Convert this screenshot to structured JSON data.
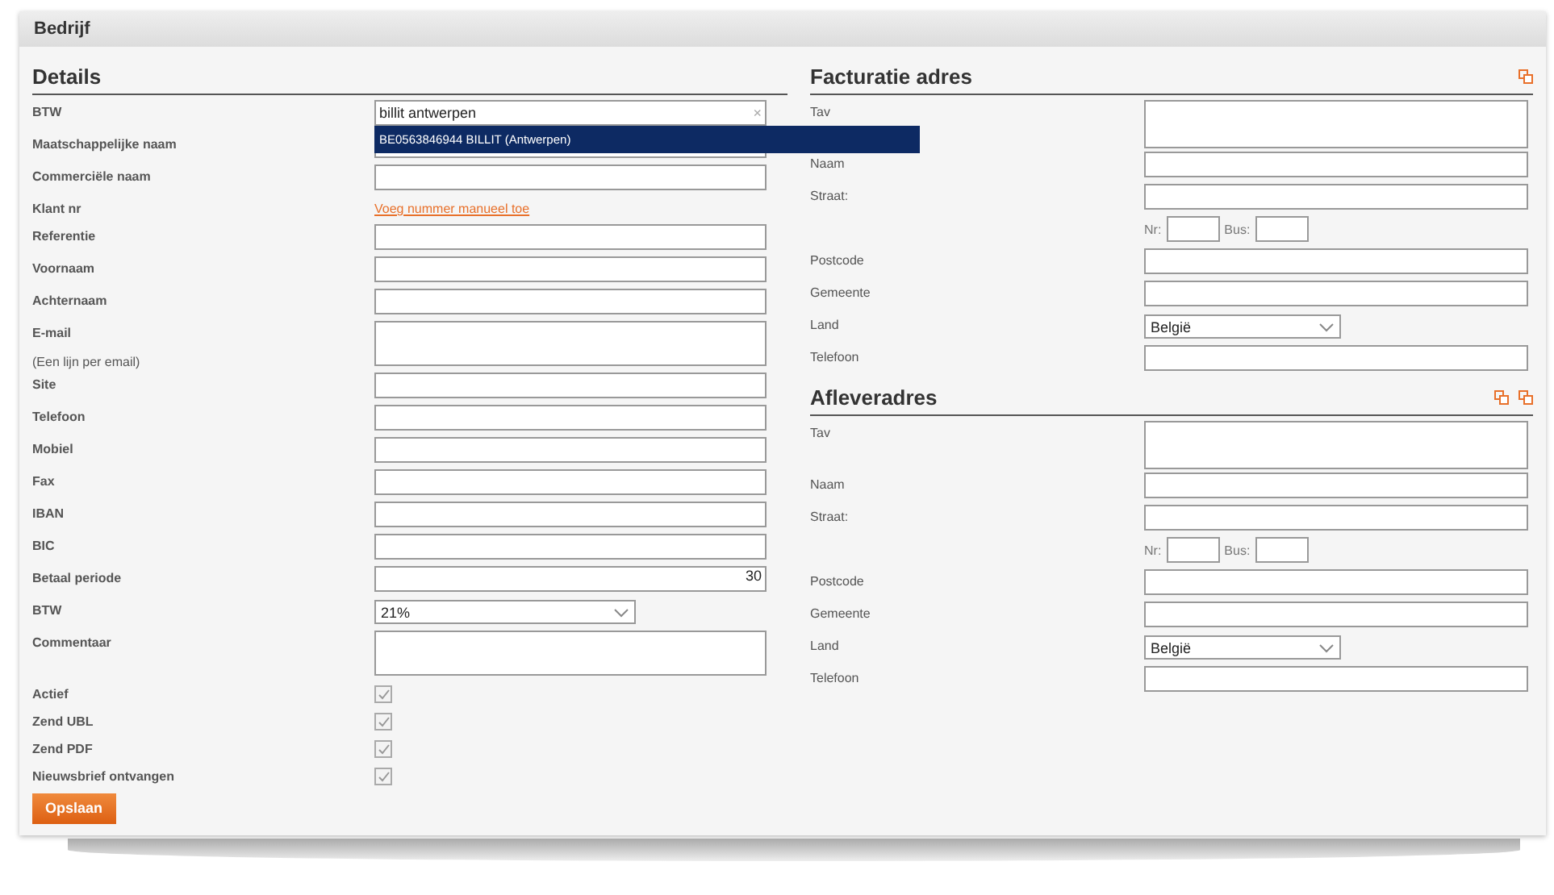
{
  "panel": {
    "title": "Bedrijf"
  },
  "details": {
    "heading": "Details",
    "rows": [
      {
        "label": "BTW",
        "kind": "autocomplete",
        "value": "billit antwerpen",
        "clear": "×",
        "suggestion": "BE0563846944 BILLIT (Antwerpen)"
      },
      {
        "label": "Maatschappelijke naam",
        "kind": "input"
      },
      {
        "label": "Commerciële naam",
        "kind": "input"
      },
      {
        "label": "Klant nr",
        "kind": "link",
        "link": "Voeg nummer manueel toe"
      },
      {
        "label": "Referentie",
        "kind": "input"
      },
      {
        "label": "Voornaam",
        "kind": "input"
      },
      {
        "label": "Achternaam",
        "kind": "input"
      },
      {
        "label": "E-mail",
        "kind": "textarea",
        "note": "(Een lijn per email)"
      },
      {
        "label": "Site",
        "kind": "input"
      },
      {
        "label": "Telefoon",
        "kind": "input"
      },
      {
        "label": "Mobiel",
        "kind": "input"
      },
      {
        "label": "Fax",
        "kind": "input"
      },
      {
        "label": "IBAN",
        "kind": "input"
      },
      {
        "label": "BIC",
        "kind": "input"
      },
      {
        "label": "Betaal periode",
        "kind": "number",
        "value": "30"
      },
      {
        "label": "BTW",
        "kind": "select",
        "value": "21%"
      },
      {
        "label": "Commentaar",
        "kind": "textarea"
      },
      {
        "label": "Actief",
        "kind": "checkbox",
        "checked": true
      },
      {
        "label": "Zend UBL",
        "kind": "checkbox",
        "checked": true
      },
      {
        "label": "Zend PDF",
        "kind": "checkbox",
        "checked": true
      },
      {
        "label": "Nieuwsbrief ontvangen",
        "kind": "checkbox",
        "checked": true
      }
    ],
    "save_button": "Opslaan"
  },
  "addresses": [
    {
      "heading": "Facturatie adres",
      "actions": [
        {
          "kind": "copy"
        }
      ],
      "rows": [
        {
          "label": "Tav",
          "kind": "textarea"
        },
        {
          "label": "Naam",
          "kind": "input"
        },
        {
          "label": "Straat:",
          "kind": "input"
        },
        {
          "kind": "nrbus",
          "nr_label": "Nr:",
          "bus_label": "Bus:"
        },
        {
          "label": "Postcode",
          "kind": "input"
        },
        {
          "label": "Gemeente",
          "kind": "input"
        },
        {
          "label": "Land",
          "kind": "select",
          "value": "België"
        },
        {
          "label": "Telefoon",
          "kind": "input"
        }
      ]
    },
    {
      "heading": "Afleveradres",
      "actions": [
        {
          "kind": "copy"
        },
        {
          "kind": "copy"
        }
      ],
      "rows": [
        {
          "label": "Tav",
          "kind": "textarea"
        },
        {
          "label": "Naam",
          "kind": "input"
        },
        {
          "label": "Straat:",
          "kind": "input"
        },
        {
          "kind": "nrbus",
          "nr_label": "Nr:",
          "bus_label": "Bus:"
        },
        {
          "label": "Postcode",
          "kind": "input"
        },
        {
          "label": "Gemeente",
          "kind": "input"
        },
        {
          "label": "Land",
          "kind": "select",
          "value": "België"
        },
        {
          "label": "Telefoon",
          "kind": "input"
        }
      ]
    }
  ]
}
